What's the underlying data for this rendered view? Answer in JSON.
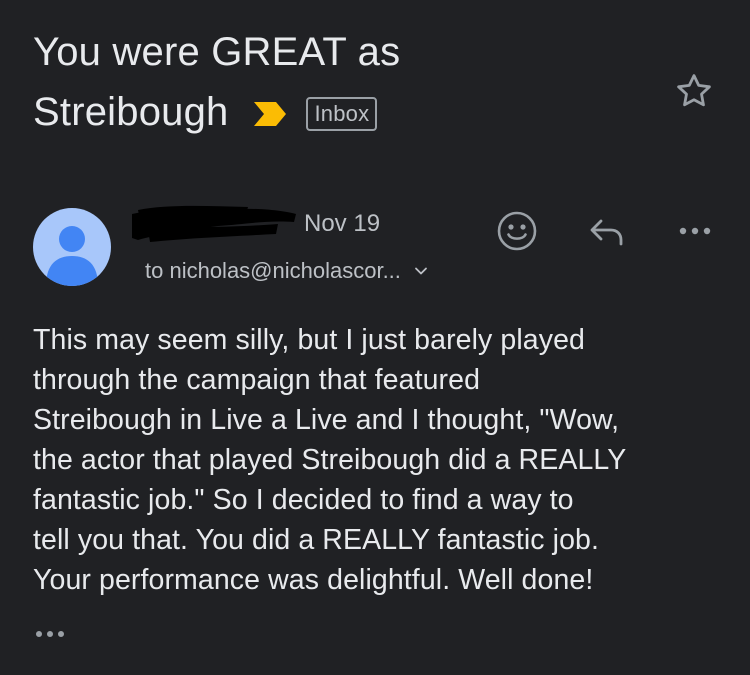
{
  "email": {
    "subject_line1": "You were GREAT as",
    "subject_line2": "Streibough",
    "label": "Inbox",
    "date": "Nov 19",
    "recipient": "to nicholas@nicholascor...",
    "body_lines": [
      "This may seem silly, but I just barely played",
      "through the campaign that featured",
      "Streibough in Live a Live and I thought, \"Wow,",
      "the actor that played Streibough did a REALLY",
      "fantastic job.\" So I decided to find a way to",
      "tell you that. You did a REALLY fantastic job.",
      "Your performance was delightful. Well done!"
    ]
  },
  "icons": {
    "importance": "importance-marker-icon",
    "star": "star-outline-icon",
    "avatar": "person-avatar-icon",
    "emoji": "add-reaction-icon",
    "reply": "reply-icon",
    "more": "more-horiz-icon",
    "expand": "chevron-down-icon",
    "trimmed": "show-trimmed-content-icon"
  },
  "colors": {
    "background": "#202124",
    "text": "#e8eaed",
    "secondary_text": "#bdc1c6",
    "importance": "#fbbc04",
    "avatar_bg": "#a8c7fa",
    "avatar_fg": "#4285f4"
  }
}
